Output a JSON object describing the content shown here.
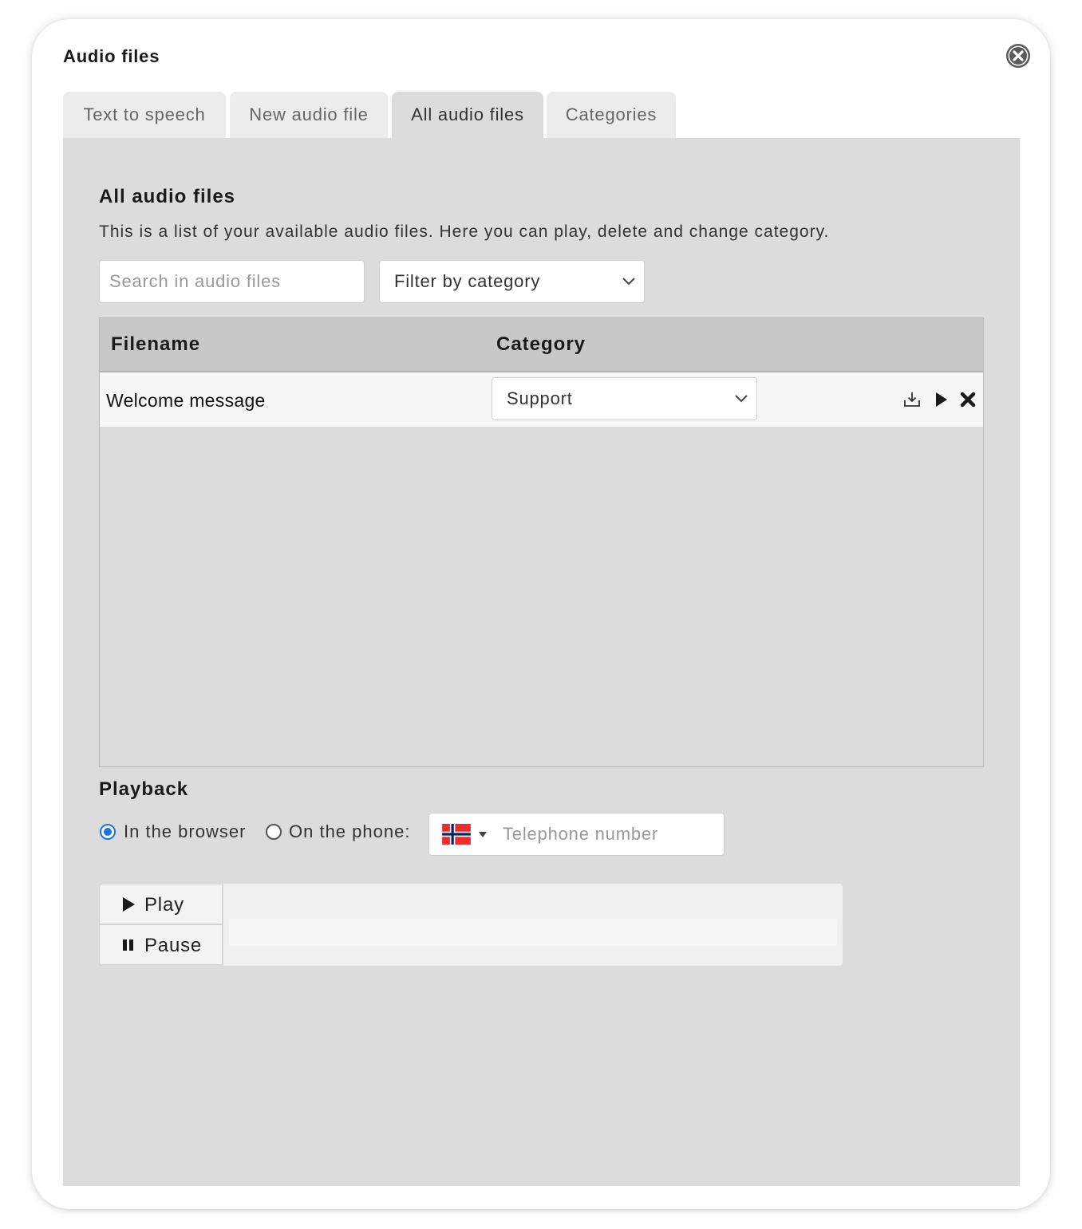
{
  "dialog": {
    "title": "Audio files"
  },
  "tabs": [
    {
      "label": "Text to speech",
      "active": false
    },
    {
      "label": "New audio file",
      "active": false
    },
    {
      "label": "All audio files",
      "active": true
    },
    {
      "label": "Categories",
      "active": false
    }
  ],
  "section": {
    "title": "All audio files",
    "description": "This is a list of your available audio files. Here you can play, delete and change category."
  },
  "search": {
    "placeholder": "Search in audio files",
    "value": ""
  },
  "filter": {
    "selected": "Filter by category"
  },
  "table": {
    "columns": [
      "Filename",
      "Category"
    ],
    "rows": [
      {
        "filename": "Welcome message",
        "category": "Support"
      }
    ]
  },
  "playback": {
    "title": "Playback",
    "option_browser": "In the browser",
    "option_phone": "On the phone:",
    "selected": "browser",
    "phone_placeholder": "Telephone number",
    "country_flag": "norway-flag-icon"
  },
  "player": {
    "play_label": "Play",
    "pause_label": "Pause",
    "progress": 0
  },
  "colors": {
    "panel_bg": "#dcdcdc",
    "header_bg": "#c8c8c8",
    "radio_accent": "#1a73e8",
    "flag_red": "#ef2b2d",
    "flag_blue": "#002868"
  }
}
